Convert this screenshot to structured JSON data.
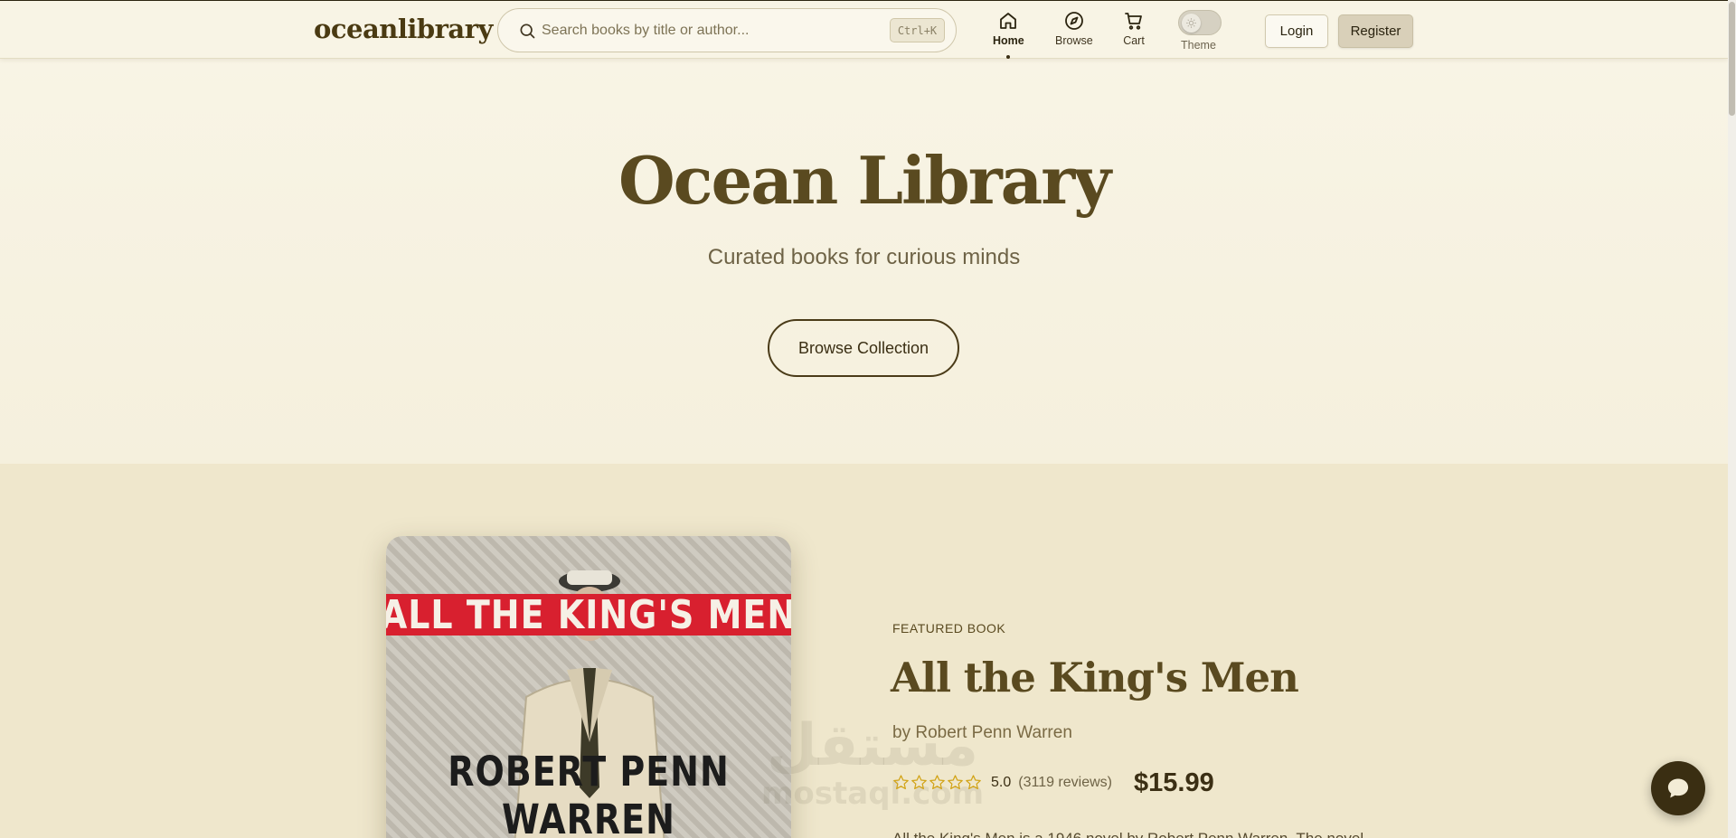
{
  "header": {
    "logo": "oceanlibrary",
    "search": {
      "placeholder": "Search books by title or author...",
      "shortcut": "Ctrl+K",
      "value": ""
    },
    "nav": [
      {
        "label": "Home",
        "icon": "home-icon",
        "active": true
      },
      {
        "label": "Browse",
        "icon": "compass-icon",
        "active": false
      },
      {
        "label": "Cart",
        "icon": "cart-icon",
        "active": false
      }
    ],
    "theme": {
      "label": "Theme",
      "icon": "sun-icon",
      "state": "light"
    },
    "login_label": "Login",
    "register_label": "Register"
  },
  "hero": {
    "title": "Ocean Library",
    "subtitle": "Curated books for curious minds",
    "cta_label": "Browse Collection"
  },
  "featured": {
    "eyebrow": "FEATURED BOOK",
    "title": "All the King's Men",
    "author": "by Robert Penn Warren",
    "rating": "5.0",
    "rating_value": 5.0,
    "reviews": "(3119 reviews)",
    "price": "$15.99",
    "description_peek": "All the King's Men is a 1946 novel by Robert Penn Warren. The novel",
    "cover": {
      "title_text": "ALL THE KING'S MEN",
      "author_text": "ROBERT PENN WARREN",
      "band_color": "#d8202f"
    }
  },
  "watermark": {
    "arabic": "مستقل",
    "latin": "mostaql.com"
  },
  "chat": {
    "icon": "chat-bubble-icon"
  },
  "colors": {
    "accent": "#5a4a20",
    "dark": "#3a2e12",
    "background": "#f7f3e4",
    "section": "#efe7cc"
  }
}
